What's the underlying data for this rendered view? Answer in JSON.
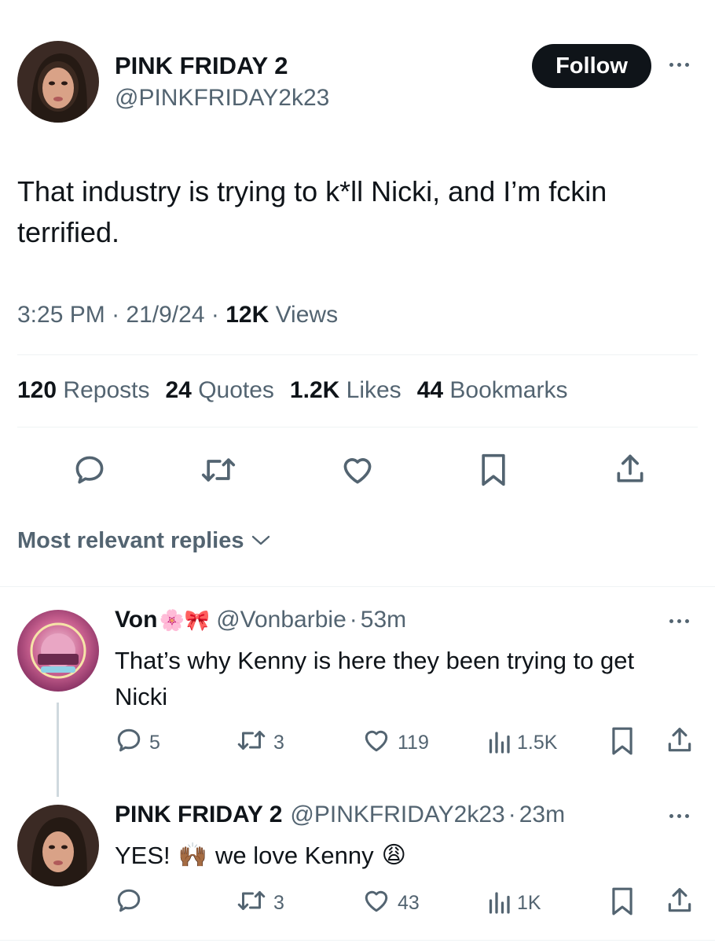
{
  "tweet": {
    "author_name": "PINK FRIDAY 2",
    "author_handle": "@PINKFRIDAY2k23",
    "follow_label": "Follow",
    "text": "That industry is trying to k*ll Nicki, and I’m fckin terrified.",
    "time": "3:25 PM",
    "date": "21/9/24",
    "views_count": "12K",
    "views_label": "Views",
    "stats": {
      "reposts_count": "120",
      "reposts_label": "Reposts",
      "quotes_count": "24",
      "quotes_label": "Quotes",
      "likes_count": "1.2K",
      "likes_label": "Likes",
      "bookmarks_count": "44",
      "bookmarks_label": "Bookmarks"
    }
  },
  "replies_sort_label": "Most relevant replies",
  "replies": [
    {
      "name": "Von",
      "handle": "@Vonbarbie",
      "time": "53m",
      "name_emoji": "🌸🎀",
      "text": "That’s why Kenny is here they been trying to get Nicki",
      "reply_count": "5",
      "repost_count": "3",
      "like_count": "119",
      "view_count": "1.5K"
    },
    {
      "name": "PINK FRIDAY 2",
      "handle": "@PINKFRIDAY2k23",
      "time": "23m",
      "text_part1": "YES!",
      "text_part2": "we love Kenny",
      "reply_count": "",
      "repost_count": "3",
      "like_count": "43",
      "view_count": "1K"
    }
  ],
  "colors": {
    "text_primary": "#0f1419",
    "text_secondary": "#536471",
    "divider": "#eff3f4",
    "follow_bg": "#0f1419"
  }
}
